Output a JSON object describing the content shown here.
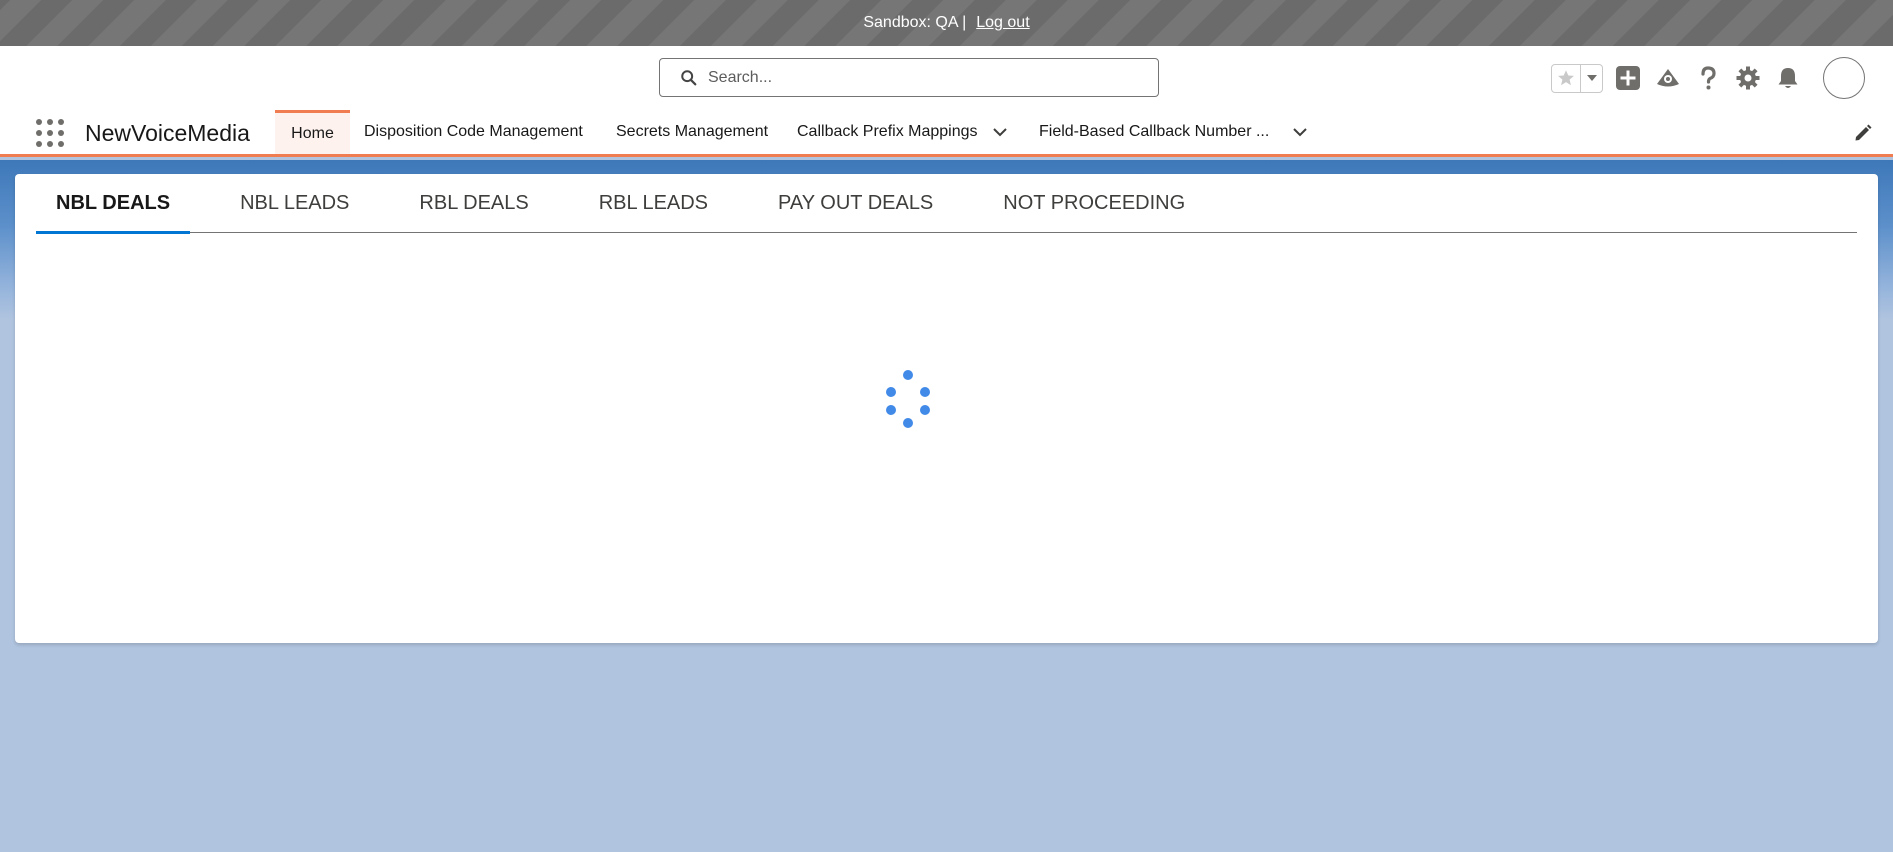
{
  "sandbox_bar": {
    "text": "Sandbox: QA |",
    "logout_label": "Log out"
  },
  "search": {
    "placeholder": "Search..."
  },
  "nav": {
    "app_name": "NewVoiceMedia",
    "items": [
      {
        "label": "Home"
      },
      {
        "label": "Disposition Code Management"
      },
      {
        "label": "Secrets Management"
      },
      {
        "label": "Callback Prefix Mappings"
      },
      {
        "label": "Field-Based Callback Number ..."
      }
    ]
  },
  "tabs": [
    {
      "label": "NBL DEALS"
    },
    {
      "label": "NBL LEADS"
    },
    {
      "label": "RBL DEALS"
    },
    {
      "label": "RBL LEADS"
    },
    {
      "label": "PAY OUT DEALS"
    },
    {
      "label": "NOT PROCEEDING"
    }
  ],
  "icons": {
    "search": "search-icon",
    "favorites": "star-icon",
    "favorites_menu": "chevron-down-icon",
    "global_create": "plus-icon",
    "trailhead": "trailhead-icon",
    "help": "question-icon",
    "setup": "gear-icon",
    "notifications": "bell-icon",
    "app_launcher": "waffle-icon",
    "edit_nav": "pencil-icon",
    "loading": "spinner-icon"
  },
  "colors": {
    "accent_nav": "#f07d52",
    "active_tab": "#0176d3",
    "spinner": "#418ae8",
    "page_bg": "#b0c4df"
  }
}
